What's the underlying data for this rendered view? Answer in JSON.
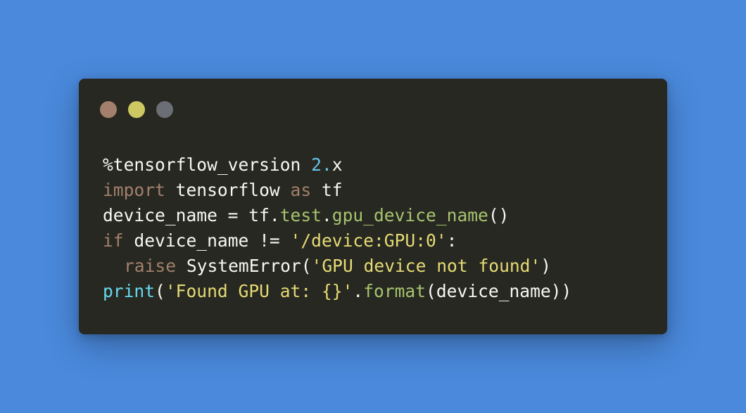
{
  "colors": {
    "background": "#4a89dc",
    "window": "#272822",
    "plain": "#f8f8f2",
    "keyword": "#a2806b",
    "number": "#66c1e8",
    "attribute": "#a6c46e",
    "string": "#e6db74",
    "builtin": "#66d9ef"
  },
  "window_controls": [
    {
      "name": "close-button",
      "color": "#a2806b"
    },
    {
      "name": "minimize-button",
      "color": "#cdc862"
    },
    {
      "name": "zoom-button",
      "color": "#6b6e74"
    }
  ],
  "code": {
    "lines": [
      {
        "tokens": [
          {
            "text": "%tensorflow_version ",
            "kind": "plain"
          },
          {
            "text": "2.",
            "kind": "number"
          },
          {
            "text": "x",
            "kind": "plain"
          }
        ]
      },
      {
        "tokens": [
          {
            "text": "import",
            "kind": "keyword"
          },
          {
            "text": " tensorflow ",
            "kind": "plain"
          },
          {
            "text": "as",
            "kind": "keyword"
          },
          {
            "text": " tf",
            "kind": "plain"
          }
        ]
      },
      {
        "tokens": [
          {
            "text": "device_name = tf.",
            "kind": "plain"
          },
          {
            "text": "test",
            "kind": "attribute"
          },
          {
            "text": ".",
            "kind": "plain"
          },
          {
            "text": "gpu_device_name",
            "kind": "attribute"
          },
          {
            "text": "()",
            "kind": "plain"
          }
        ]
      },
      {
        "tokens": [
          {
            "text": "if",
            "kind": "keyword"
          },
          {
            "text": " device_name != ",
            "kind": "plain"
          },
          {
            "text": "'/device:GPU:0'",
            "kind": "string"
          },
          {
            "text": ":",
            "kind": "plain"
          }
        ]
      },
      {
        "indent": true,
        "tokens": [
          {
            "text": "raise",
            "kind": "keyword"
          },
          {
            "text": " SystemError(",
            "kind": "plain"
          },
          {
            "text": "'GPU device not found'",
            "kind": "string"
          },
          {
            "text": ")",
            "kind": "plain"
          }
        ]
      },
      {
        "tokens": [
          {
            "text": "print",
            "kind": "builtin"
          },
          {
            "text": "(",
            "kind": "plain"
          },
          {
            "text": "'Found GPU at: {}'",
            "kind": "string"
          },
          {
            "text": ".",
            "kind": "plain"
          },
          {
            "text": "format",
            "kind": "attribute"
          },
          {
            "text": "(device_name))",
            "kind": "plain"
          }
        ]
      }
    ]
  }
}
